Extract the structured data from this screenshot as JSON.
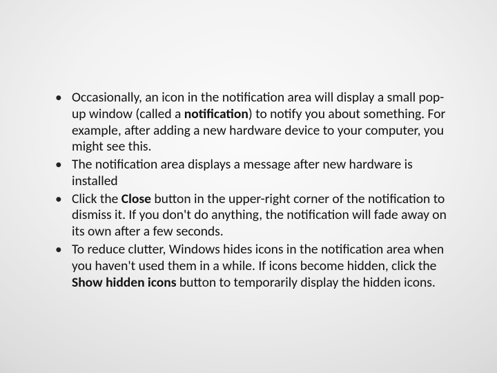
{
  "bullets": [
    {
      "segments": [
        {
          "t": "Occasionally, an icon in the notification area will display a small pop-up window (called a ",
          "b": false
        },
        {
          "t": "notification",
          "b": true
        },
        {
          "t": ") to notify you about something. For example, after adding a new hardware device to your computer, you might see this.",
          "b": false
        }
      ]
    },
    {
      "segments": [
        {
          "t": "The notification area displays a message after new hardware is installed",
          "b": false
        }
      ]
    },
    {
      "segments": [
        {
          "t": "Click the ",
          "b": false
        },
        {
          "t": "Close",
          "b": true
        },
        {
          "t": " button   in the upper-right corner of the notification to dismiss it. If you don't do anything, the notification will fade away on its own after a few seconds.",
          "b": false
        }
      ]
    },
    {
      "segments": [
        {
          "t": "To reduce clutter, Windows hides icons in the notification area when you haven't used them in a while. If icons become hidden, click the ",
          "b": false
        },
        {
          "t": "Show hidden icons",
          "b": true
        },
        {
          "t": " button to temporarily display the hidden icons.",
          "b": false
        }
      ]
    }
  ]
}
